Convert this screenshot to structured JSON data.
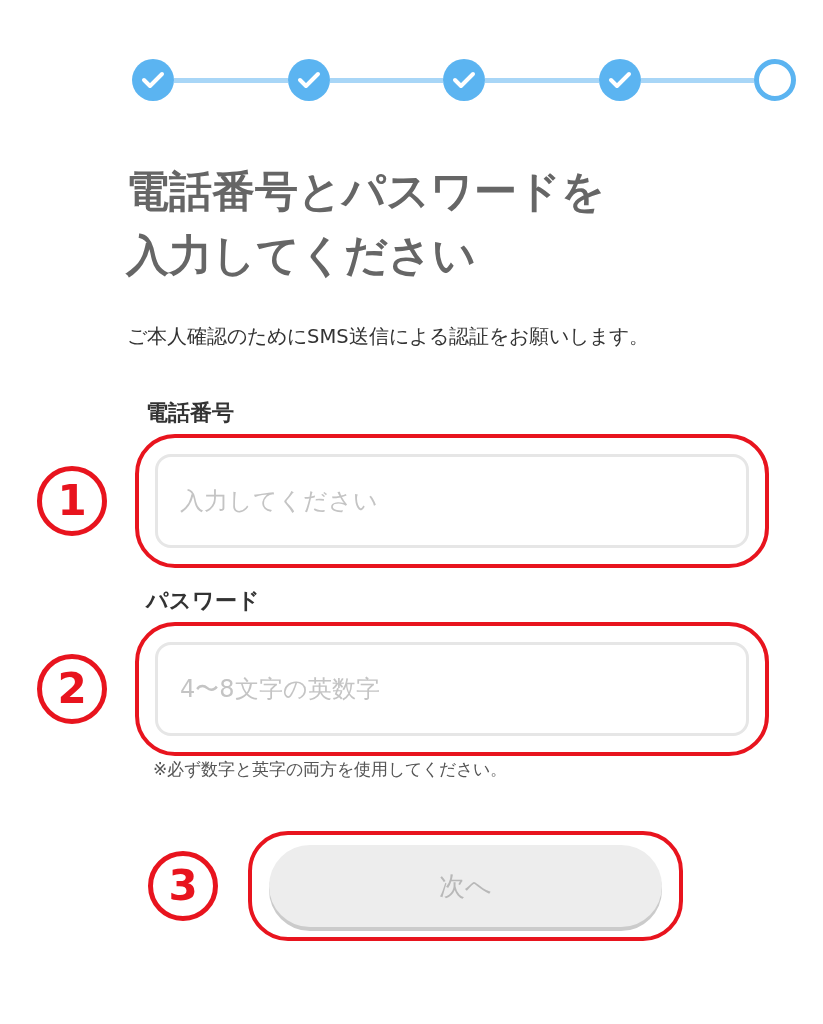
{
  "stepper": {
    "steps": [
      {
        "done": true
      },
      {
        "done": true
      },
      {
        "done": true
      },
      {
        "done": true
      },
      {
        "done": false
      }
    ]
  },
  "title": "電話番号とパスワードを入力してください",
  "subtitle": "ご本人確認のためにSMS送信による認証をお願いします。",
  "fields": [
    {
      "label": "電話番号",
      "placeholder": "入力してください",
      "annotation": "1"
    },
    {
      "label": "パスワード",
      "placeholder": "4〜8文字の英数字",
      "annotation": "2",
      "note": "※必ず数字と英字の両方を使用してください。"
    }
  ],
  "button": {
    "label": "次へ",
    "disabled": true,
    "annotation": "3"
  }
}
